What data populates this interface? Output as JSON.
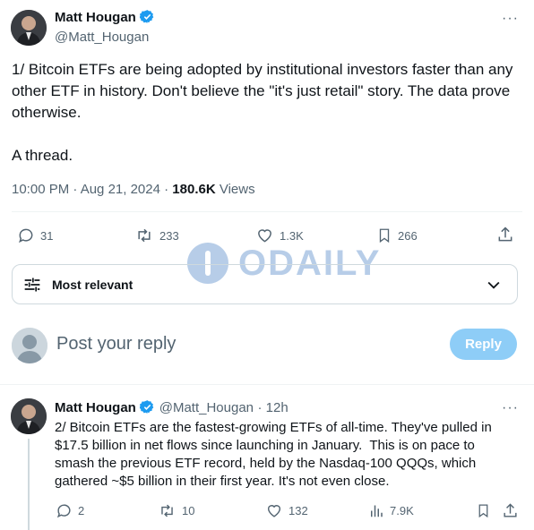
{
  "tweet": {
    "author_name": "Matt Hougan",
    "author_handle": "@Matt_Hougan",
    "text": "1/ Bitcoin ETFs are being adopted by institutional investors faster than any other ETF in history. Don't believe the \"it's just retail\" story. The data prove otherwise.\n\nA thread.",
    "time": "10:00 PM · Aug 21, 2024 ·",
    "views_count": "180.6K",
    "views_label": "Views",
    "replies": "31",
    "reposts": "233",
    "likes": "1.3K",
    "bookmarks": "266"
  },
  "sort": {
    "label": "Most relevant"
  },
  "compose": {
    "placeholder": "Post your reply",
    "button": "Reply"
  },
  "watermark": {
    "text": "ODAILY"
  },
  "reply": {
    "author_name": "Matt Hougan",
    "author_handle": "@Matt_Hougan",
    "age": "· 12h",
    "text": "2/ Bitcoin ETFs are the fastest-growing ETFs of all-time. They've pulled in $17.5 billion in net flows since launching in January.  This is on pace to smash the previous ETF record, held by the Nasdaq-100 QQQs, which gathered ~$5 billion in their first year. It's not even close.",
    "replies": "2",
    "reposts": "10",
    "likes": "132",
    "views": "7.9K"
  },
  "colors": {
    "accent": "#1d9bf0",
    "reply_button": "#8ecdf7",
    "muted": "#536471"
  }
}
